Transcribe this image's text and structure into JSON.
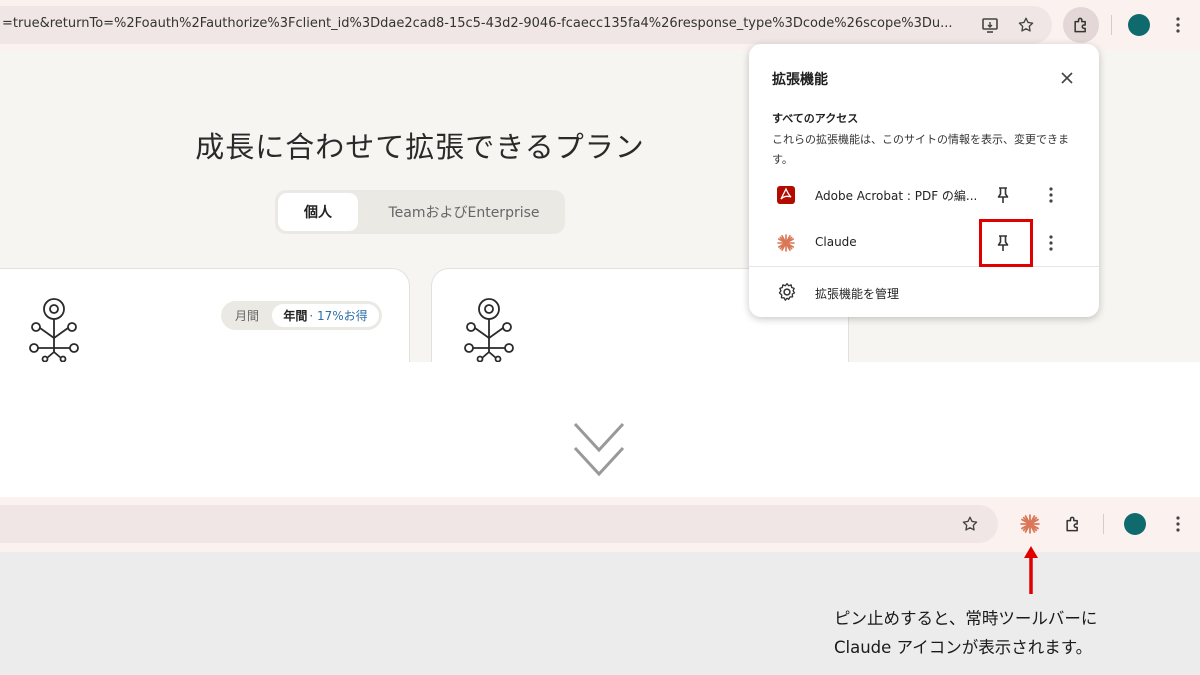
{
  "browser": {
    "url": "=true&returnTo=%2Foauth%2Fauthorize%3Fclient_id%3Ddae2cad8-15c5-43d2-9046-fcaecc135fa4%26response_type%3Dcode%26scope%3Du..."
  },
  "page": {
    "title": "成長に合わせて拡張できるプラン",
    "plan_toggle": {
      "personal": "個人",
      "team": "TeamおよびEnterprise"
    },
    "billing_toggle": {
      "monthly": "月間",
      "yearly": "年間",
      "discount": "· 17%お得"
    }
  },
  "extensions_popup": {
    "title": "拡張機能",
    "close_icon": "close-icon",
    "section_title": "すべてのアクセス",
    "section_desc": "これらの拡張機能は、このサイトの情報を表示、変更できます。",
    "items": [
      {
        "name": "Adobe Acrobat : PDF の編...",
        "icon": "acrobat-icon"
      },
      {
        "name": "Claude",
        "icon": "claude-icon"
      }
    ],
    "manage_label": "拡張機能を管理"
  },
  "annotation": {
    "line1": "ピン止めすると、常時ツールバーに",
    "line2": "Claude アイコンが表示されます。"
  },
  "colors": {
    "highlight": "#e00000",
    "claude": "#d97757",
    "avatar": "#0f6a6e",
    "discount": "#2f6fa8"
  }
}
